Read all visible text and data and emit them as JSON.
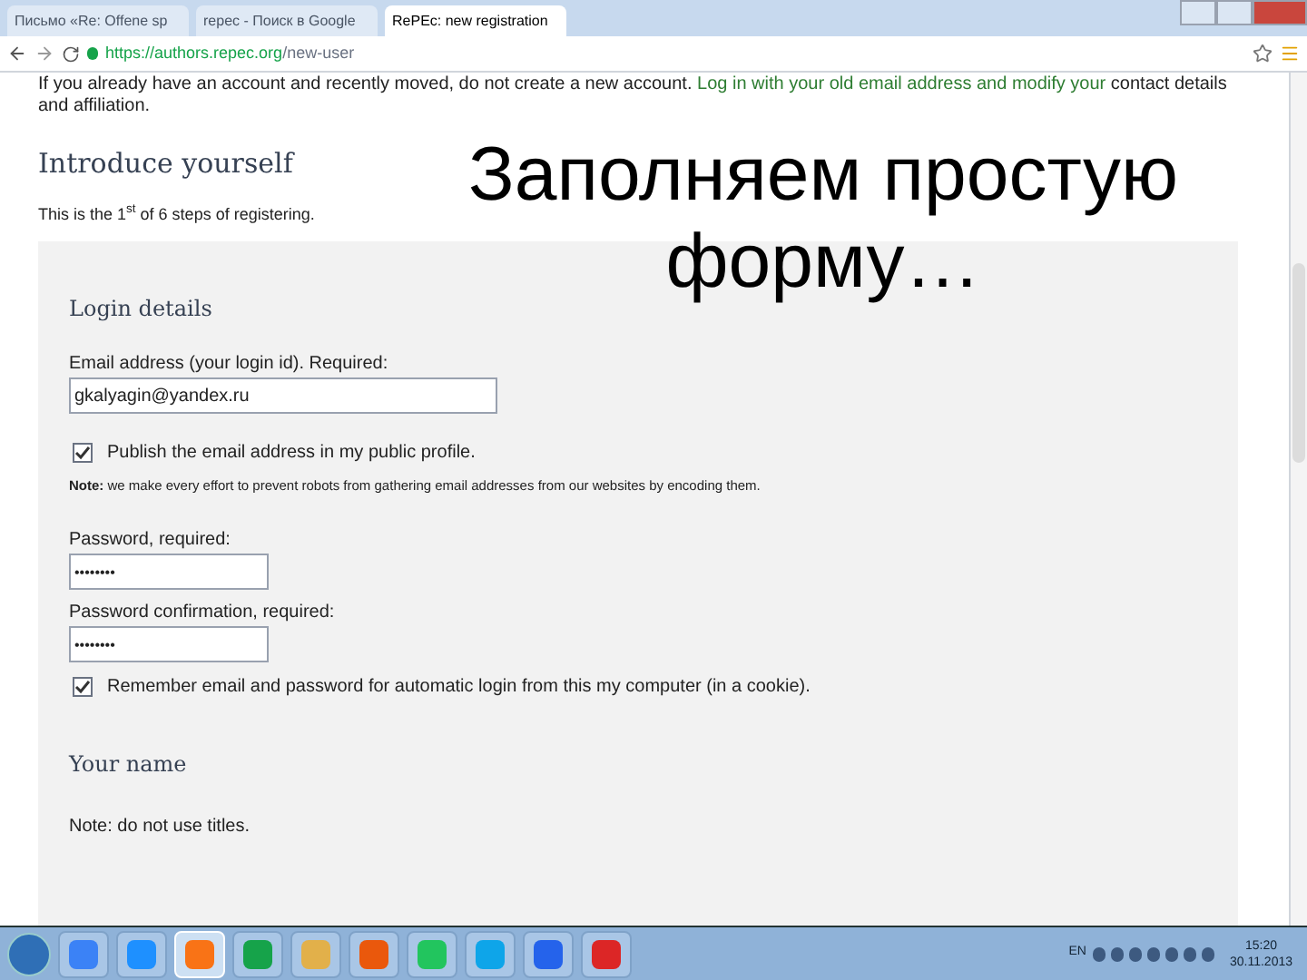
{
  "browser": {
    "tabs": [
      {
        "title": "Письмо «Re: Offene sp",
        "selected": false
      },
      {
        "title": "repec - Поиск в Google",
        "selected": false
      },
      {
        "title": "RePEc: new registration",
        "selected": true
      }
    ],
    "address": {
      "host": "https://authors.repec.org",
      "path": "/new-user"
    }
  },
  "page": {
    "intro_text": "If you already have an account and recently moved, do not create a new account.",
    "intro_link": "Log in with your old email address and modify your",
    "intro_text_2": "contact details and affiliation.",
    "heading": "Introduce yourself",
    "steps_text": "This is the 1$^{st}$ of 6 steps of registering.",
    "form": {
      "section_title": "Login details",
      "email_label": "Email address (your login id). Required:",
      "email_value": "gkalyagin@yandex.ru",
      "publish": {
        "label": "Publish the email address in my public profile.",
        "checked": true
      },
      "note": "**Note:** we make every effort to prevent robots from gathering email addresses from our websites by encoding them.",
      "password_label": "Password, required:",
      "password_value": "••••••••",
      "confirm_label": "Password confirmation, required:",
      "confirm_value": "••••••••",
      "remember": {
        "label": "Remember email and password for automatic login from this my computer (in a cookie).",
        "checked": true
      },
      "name_title": "Your name",
      "name_note": "Note: do not use titles."
    }
  },
  "overlay_caption": "Заполняем простую форму…",
  "taskbar": {
    "apps": [
      {
        "selected": false
      },
      {
        "selected": false
      },
      {
        "selected": true
      },
      {
        "selected": false
      },
      {
        "selected": false
      },
      {
        "selected": false
      },
      {
        "selected": false
      },
      {
        "selected": false
      },
      {
        "selected": false
      },
      {
        "selected": false
      }
    ],
    "language": "EN",
    "time": "15:20",
    "date": "30.11.2013"
  }
}
